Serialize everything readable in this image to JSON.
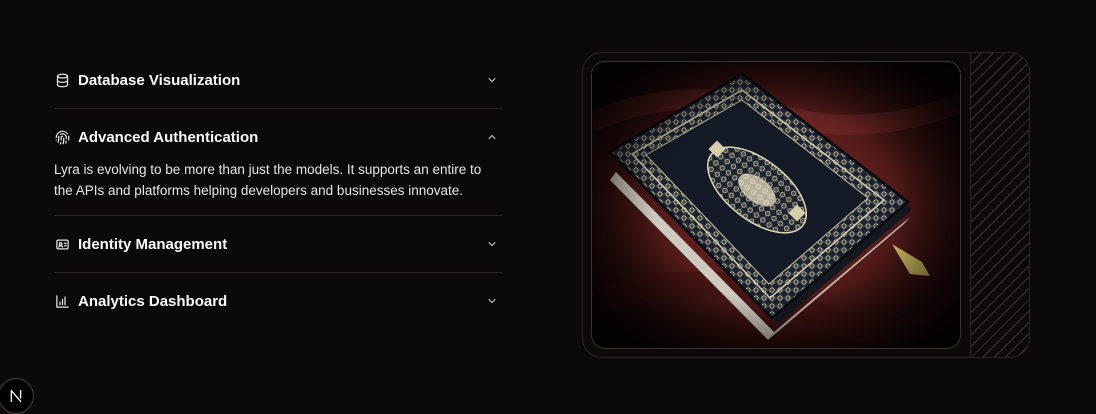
{
  "accordion": {
    "items": [
      {
        "title": "Database Visualization",
        "icon": "database-icon",
        "expanded": false
      },
      {
        "title": "Advanced Authentication",
        "icon": "fingerprint-icon",
        "expanded": true,
        "body": "Lyra is evolving to be more than just the models. It supports an entire to the APIs and platforms helping developers and businesses innovate."
      },
      {
        "title": "Identity Management",
        "icon": "id-card-icon",
        "expanded": false
      },
      {
        "title": "Analytics Dashboard",
        "icon": "bar-chart-icon",
        "expanded": false
      }
    ]
  },
  "media": {
    "image": "quran-book-photo"
  },
  "badge": {
    "label": "N",
    "icon": "nextjs-logo-icon"
  },
  "colors": {
    "background": "#0c0a09",
    "border": "#292524",
    "text": "#fafaf9"
  }
}
